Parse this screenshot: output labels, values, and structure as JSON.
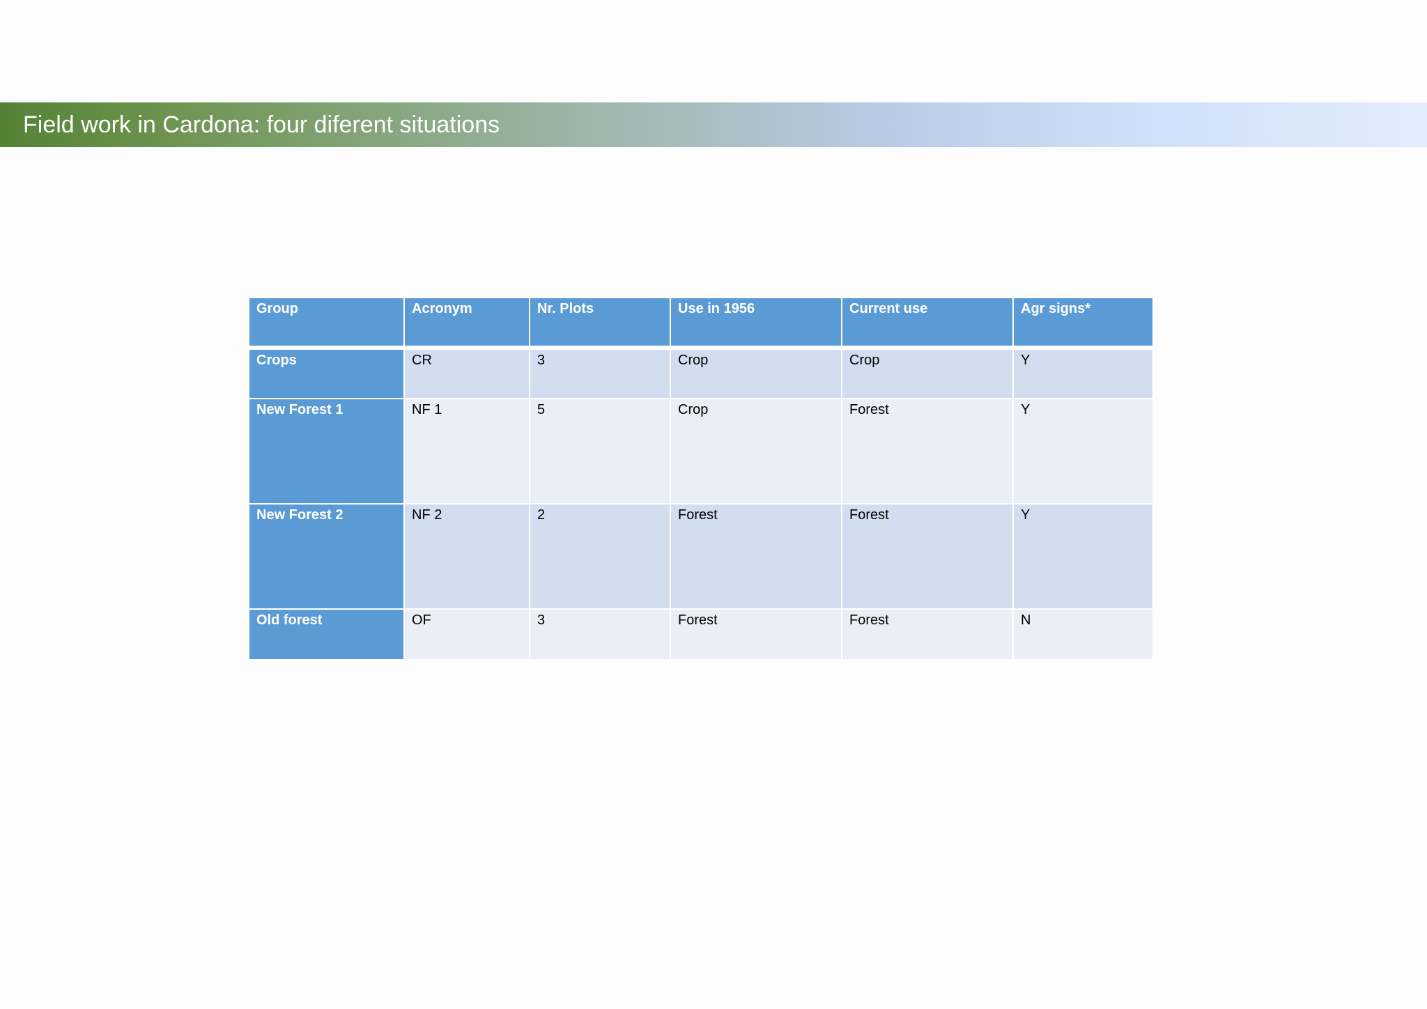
{
  "slide": {
    "title": "Field work in Cardona: four diferent situations"
  },
  "table": {
    "headers": [
      "Group",
      "Acronym",
      "Nr. Plots",
      "Use in 1956",
      "Current use",
      "Agr signs*"
    ],
    "rows": [
      {
        "group": "Crops",
        "acronym": "CR",
        "plots": "3",
        "use1956": "Crop",
        "current": "Crop",
        "agr": "Y"
      },
      {
        "group": "New Forest 1",
        "acronym": "NF 1",
        "plots": "5",
        "use1956": "Crop",
        "current": "Forest",
        "agr": "Y"
      },
      {
        "group": "New Forest 2",
        "acronym": "NF 2",
        "plots": "2",
        "use1956": "Forest",
        "current": "Forest",
        "agr": "Y"
      },
      {
        "group": "Old forest",
        "acronym": "OF",
        "plots": "3",
        "use1956": "Forest",
        "current": "Forest",
        "agr": "N"
      }
    ]
  },
  "colors": {
    "header_blue": "#5b9bd5",
    "row_band_dark": "#d2deef",
    "row_band_light": "#eaeff7",
    "title_green": "#548235"
  }
}
